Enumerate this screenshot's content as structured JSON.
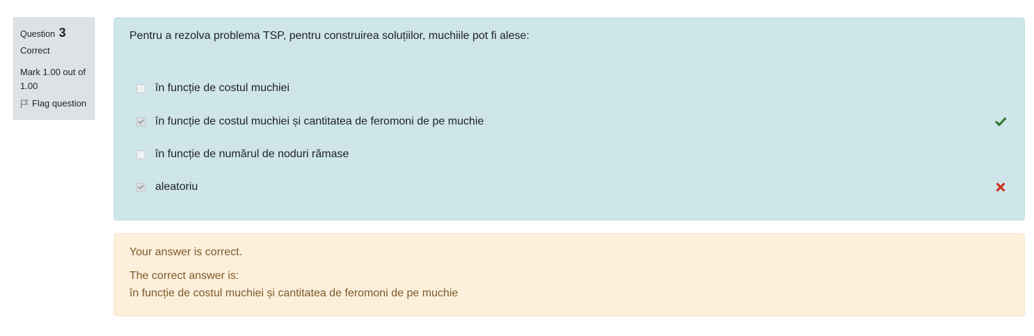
{
  "info": {
    "question_label": "Question",
    "question_number": "3",
    "state": "Correct",
    "grade": "Mark 1.00 out of 1.00",
    "flag_label": "Flag question",
    "flag_icon": "flag-icon"
  },
  "question": {
    "text": "Pentru a rezolva problema TSP, pentru construirea soluțiilor, muchiile pot fi alese:",
    "answers": [
      {
        "label": "în funcție de costul muchiei",
        "checked": false,
        "mark": ""
      },
      {
        "label": "în funcție de costul muchiei și cantitatea de feromoni de pe muchie",
        "checked": true,
        "mark": "correct"
      },
      {
        "label": "în funcție de numărul de noduri rămase",
        "checked": false,
        "mark": ""
      },
      {
        "label": "aleatoriu",
        "checked": true,
        "mark": "incorrect"
      }
    ]
  },
  "outcome": {
    "feedback": "Your answer is correct.",
    "right_answer_label": "The correct answer is:",
    "right_answer": "în funcție de costul muchiei și cantitatea de feromoni de pe muchie"
  },
  "colors": {
    "formulation_bg": "#cee5ea",
    "outcome_bg": "#fcefdc",
    "outcome_text": "#7d5a29",
    "correct": "#357a32",
    "incorrect": "#ca3120"
  }
}
